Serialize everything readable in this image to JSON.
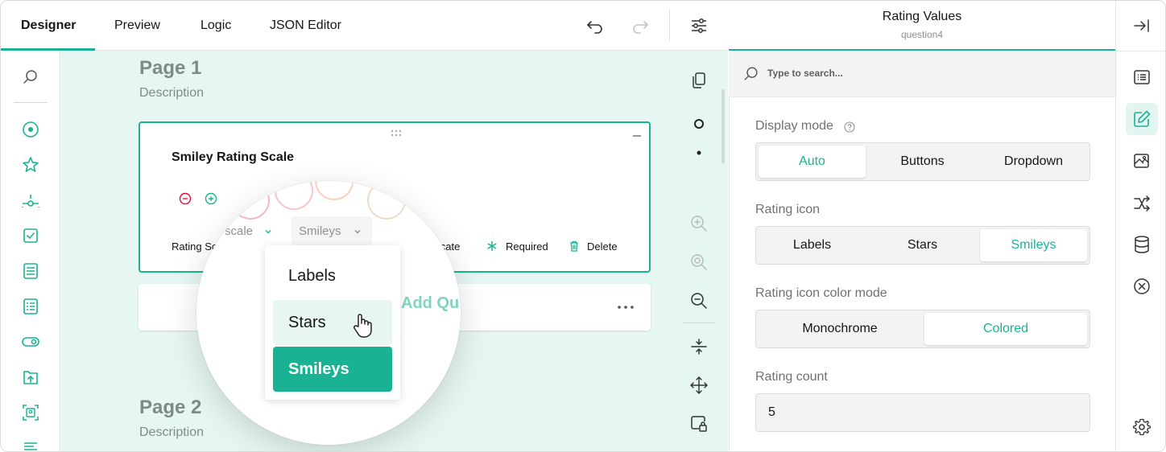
{
  "tabs": [
    {
      "label": "Designer",
      "active": true
    },
    {
      "label": "Preview",
      "active": false
    },
    {
      "label": "Logic",
      "active": false
    },
    {
      "label": "JSON Editor",
      "active": false
    }
  ],
  "toolbar_icons": [
    "undo-icon",
    "redo-icon",
    "settings-sliders-icon"
  ],
  "toolbox_icons": [
    "search-icon",
    "radiogroup-icon",
    "rating-icon",
    "slider-icon",
    "checkbox-icon",
    "dropdown-icon",
    "matrix-icon",
    "boolean-icon",
    "file-upload-icon",
    "image-picker-icon",
    "text-icon"
  ],
  "canvas": {
    "page1": {
      "title": "Page 1",
      "description": "Description"
    },
    "page2": {
      "title": "Page 2",
      "description": "Description"
    },
    "question": {
      "title": "Smiley Rating Scale",
      "footer_left": "Rating Sc",
      "footer_duplicate": "licate",
      "required_label": "Required",
      "delete_label": "Delete"
    },
    "add_question_label": "Add Qu",
    "magnifier": {
      "scale_label": "scale",
      "rate_type_label": "Smileys",
      "options": [
        "Labels",
        "Stars",
        "Smileys"
      ],
      "hovered": "Stars",
      "selected": "Smileys"
    }
  },
  "properties": {
    "title": "Rating Values",
    "subtitle": "question4",
    "search_placeholder": "Type to search...",
    "display_mode": {
      "label": "Display mode",
      "options": [
        "Auto",
        "Buttons",
        "Dropdown"
      ],
      "selected": "Auto"
    },
    "rating_icon": {
      "label": "Rating icon",
      "options": [
        "Labels",
        "Stars",
        "Smileys"
      ],
      "selected": "Smileys"
    },
    "color_mode": {
      "label": "Rating icon color mode",
      "options": [
        "Monochrome",
        "Colored"
      ],
      "selected": "Colored"
    },
    "rating_count": {
      "label": "Rating count",
      "value": "5"
    }
  },
  "colors": {
    "accent": "#19b394",
    "danger": "#e60a3e",
    "canvas_bg": "#e6f6f2"
  }
}
